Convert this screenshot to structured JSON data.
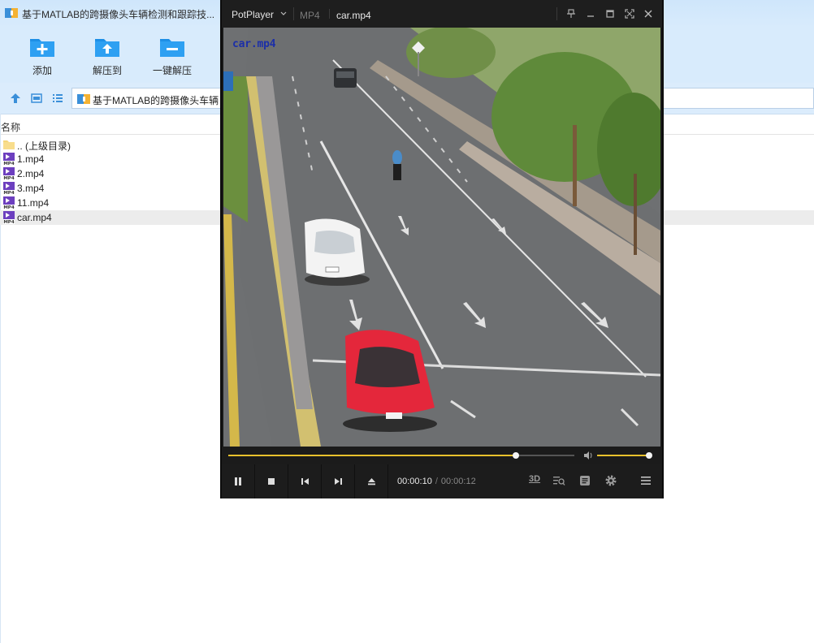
{
  "archive": {
    "window_title": "基于MATLAB的跨摄像头车辆检测和跟踪技...",
    "toolbar": [
      {
        "label": "添加",
        "icon": "add-folder-icon"
      },
      {
        "label": "解压到",
        "icon": "extract-to-icon"
      },
      {
        "label": "一键解压",
        "icon": "one-click-extract-icon"
      }
    ],
    "path": "基于MATLAB的跨摄像头车辆",
    "column_header": "名称",
    "files": [
      {
        "name": ".. (上级目录)",
        "type": "parent-folder"
      },
      {
        "name": "1.mp4",
        "type": "mp4"
      },
      {
        "name": "2.mp4",
        "type": "mp4"
      },
      {
        "name": "3.mp4",
        "type": "mp4"
      },
      {
        "name": "11.mp4",
        "type": "mp4"
      },
      {
        "name": "car.mp4",
        "type": "mp4",
        "selected": true
      }
    ],
    "colors": {
      "toolbar_bg": "#d8ebfc",
      "icon_blue": "#1d8fe6"
    }
  },
  "player": {
    "app_name": "PotPlayer",
    "format": "MP4",
    "file_name": "car.mp4",
    "video_overlay_text": "car.mp4",
    "current_time": "00:00:10",
    "total_time": "00:00:12",
    "progress_fraction": 0.83,
    "volume_fraction": 0.97,
    "right_buttons": [
      "3D",
      "playlist-search-icon",
      "subtitle-icon",
      "settings-icon",
      "menu-icon"
    ],
    "controls": [
      "pause-icon",
      "stop-icon",
      "previous-icon",
      "next-icon",
      "eject-icon"
    ],
    "colors": {
      "accent": "#e8c12c",
      "bg": "#1c1c1c"
    }
  }
}
